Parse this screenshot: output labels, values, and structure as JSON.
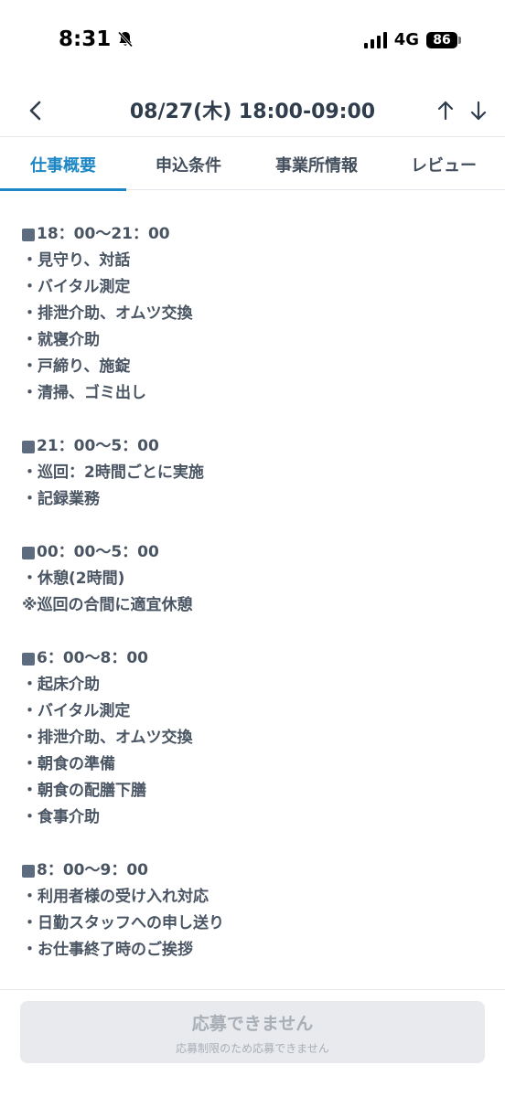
{
  "status": {
    "time": "8:31",
    "network": "4G",
    "battery": "86"
  },
  "nav": {
    "title": "08/27(木) 18:00-09:00"
  },
  "tabs": [
    {
      "label": "仕事概要",
      "active": true
    },
    {
      "label": "申込条件",
      "active": false
    },
    {
      "label": "事業所情報",
      "active": false
    },
    {
      "label": "レビュー",
      "active": false
    }
  ],
  "sections": [
    {
      "header": "18：00〜21：00",
      "lines": [
        "・見守り、対話",
        "・バイタル測定",
        "・排泄介助、オムツ交換",
        "・就寝介助",
        "・戸締り、施錠",
        "・清掃、ゴミ出し"
      ]
    },
    {
      "header": "21：00〜5：00",
      "lines": [
        "・巡回：2時間ごとに実施",
        "・記録業務"
      ]
    },
    {
      "header": "00：00〜5：00",
      "lines": [
        "・休憩(2時間)",
        "※巡回の合間に適宜休憩"
      ]
    },
    {
      "header": "6：00〜8：00",
      "lines": [
        "・起床介助",
        "・バイタル測定",
        "・排泄介助、オムツ交換",
        "・朝食の準備",
        "・朝食の配膳下膳",
        "・食事介助"
      ]
    },
    {
      "header": "8：00〜9：00",
      "lines": [
        "・利用者様の受け入れ対応",
        "・日勤スタッフへの申し送り",
        "・お仕事終了時のご挨拶"
      ]
    }
  ],
  "footer": {
    "button_label": "応募できません",
    "button_sublabel": "応募制限のため応募できません"
  },
  "colors": {
    "accent": "#1d86c4",
    "text": "#2f3d4d",
    "disabled_bg": "#e8eaed",
    "disabled_text": "#a9afb6"
  }
}
